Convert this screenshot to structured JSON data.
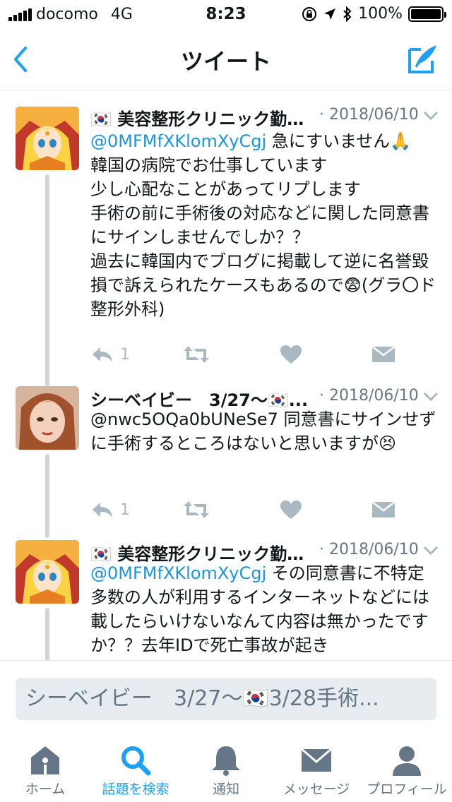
{
  "status_bar": {
    "carrier": "docomo",
    "network": "4G",
    "time": "8:23",
    "battery": "100%",
    "battery_level": 1.0
  },
  "nav": {
    "title": "ツイート",
    "back_icon": "chevron-left-icon",
    "compose_icon": "compose-tweet-icon"
  },
  "tweets": [
    {
      "author": "🇰🇷 美容整形クリニック勤務...",
      "date": "· 2018/06/10",
      "mention": "@0MFMfXKlomXyCgj",
      "text": " 急にすいません🙏\n韓国の病院でお仕事しています\n少し心配なことがあってリプします\n手術の前に手術後の対応などに関した同意書にサインしませんでしか？？\n過去に韓国内でブログに掲載して逆に名誉毀損で訴えられたケースもあるので😨(グラ〇ド整形外科)",
      "reply_count": "1"
    },
    {
      "author": "シーベイビー　3/27〜🇰🇷...",
      "date": "· 2018/06/10",
      "mention": "",
      "text": "@nwc5OQa0bUNeSe7 同意書にサインせずに手術するところはないと思いますが😣",
      "reply_count": "1"
    },
    {
      "author": "🇰🇷 美容整形クリニック勤務...",
      "date": "· 2018/06/10",
      "mention": "@0MFMfXKlomXyCgj",
      "text": " その同意書に不特定多数の人が利用するインターネットなどには載したらいけないなんて内容は無かったですか？？去年IDで死亡事故が起き"
    }
  ],
  "reply": {
    "placeholder": "シーベイビー　3/27〜🇰🇷3/28手術..."
  },
  "tabs": [
    {
      "label": "ホーム",
      "icon": "home-icon",
      "active": false
    },
    {
      "label": "話題を検索",
      "icon": "search-icon",
      "active": true
    },
    {
      "label": "通知",
      "icon": "bell-icon",
      "active": false
    },
    {
      "label": "メッセージ",
      "icon": "envelope-icon",
      "active": false
    },
    {
      "label": "プロフィール",
      "icon": "person-icon",
      "active": false
    }
  ],
  "colors": {
    "accent": "#1da1f2",
    "mention": "#1b95e0",
    "muted": "#657786",
    "action_icon": "#aab8c2",
    "thread_line": "#ccd6dd"
  }
}
